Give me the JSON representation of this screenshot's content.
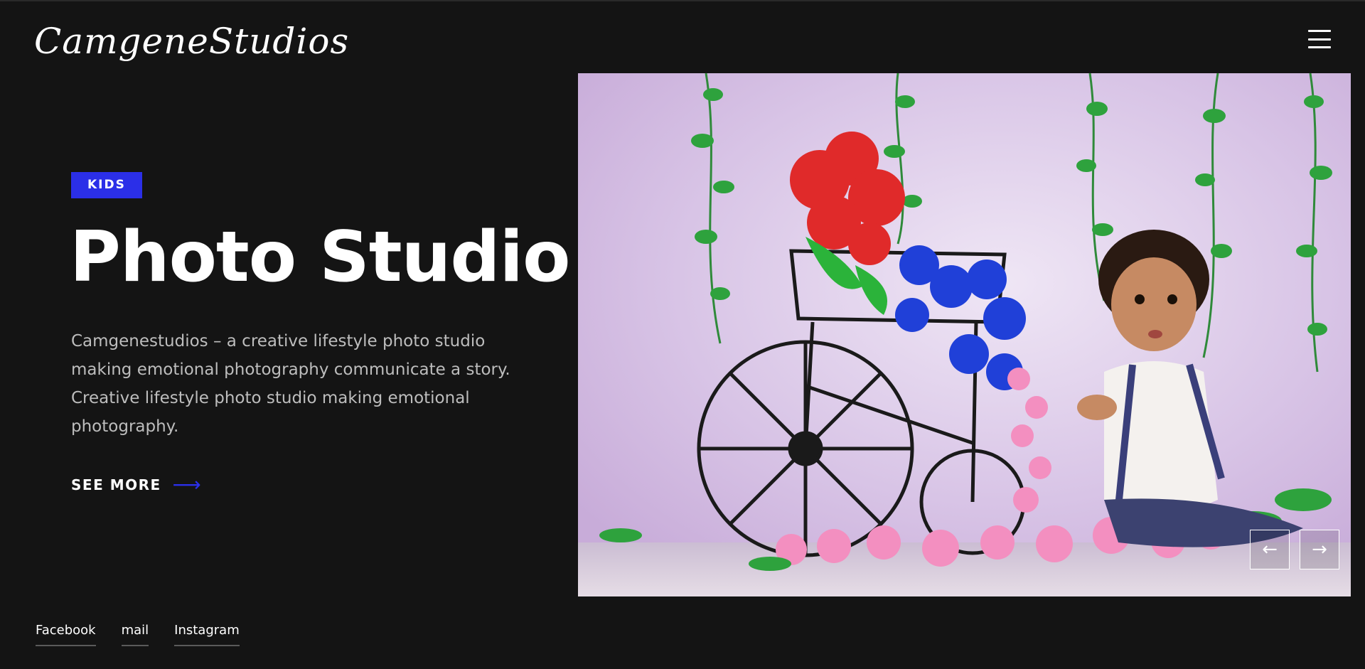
{
  "header": {
    "logo_text": "CamgeneStudios",
    "menu_icon": "hamburger-menu-icon"
  },
  "hero": {
    "badge": "KIDS",
    "title": "Photo Studio",
    "description": "Camgenestudios – a creative lifestyle photo studio making emotional photography communicate a story. Creative lifestyle photo studio making emotional photography.",
    "cta_label": "SEE MORE",
    "cta_icon": "arrow-right-icon"
  },
  "slider": {
    "prev_icon": "arrow-left-icon",
    "next_icon": "arrow-right-icon",
    "prev_glyph": "←",
    "next_glyph": "→"
  },
  "social": {
    "links": [
      {
        "label": "Facebook"
      },
      {
        "label": "mail"
      },
      {
        "label": "Instagram"
      }
    ]
  },
  "colors": {
    "background": "#141414",
    "accent": "#2b2fe8",
    "text": "#ffffff",
    "muted_text": "#bdbdbd"
  }
}
